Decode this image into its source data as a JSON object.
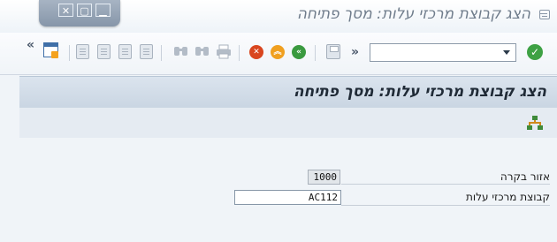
{
  "window": {
    "title": "הצג קבוצת מרכזי עלות: מסך פתיחה",
    "controls": {
      "close": "✕",
      "restore": "▢",
      "minimize": "▁"
    }
  },
  "toolbar": {
    "ok_symbol": "✓",
    "command_field_value": "",
    "more_symbol": "»",
    "overflow_symbol": "«",
    "buttons": [
      "enter-icon",
      "save-icon",
      "back-icon",
      "exit-icon",
      "cancel-icon",
      "print-icon",
      "find-icon",
      "find-next-icon",
      "first-page-icon",
      "previous-page-icon",
      "next-page-icon",
      "last-page-icon",
      "create-session-icon"
    ]
  },
  "screen": {
    "title": "הצג קבוצת מרכזי עלות: מסך פתיחה",
    "app_toolbar_icon": "hierarchy-icon"
  },
  "form": {
    "fields": [
      {
        "label": "אזור בקרה",
        "value": "1000",
        "editable": false
      },
      {
        "label": "קבוצת מרכזי עלות",
        "value": "AC112",
        "editable": true
      }
    ]
  },
  "colors": {
    "header_band": "#c9d5e2",
    "ok_green": "#3ea144",
    "cancel_red": "#d9461f",
    "exit_orange": "#f0a020",
    "back_green": "#3a9a3f"
  }
}
